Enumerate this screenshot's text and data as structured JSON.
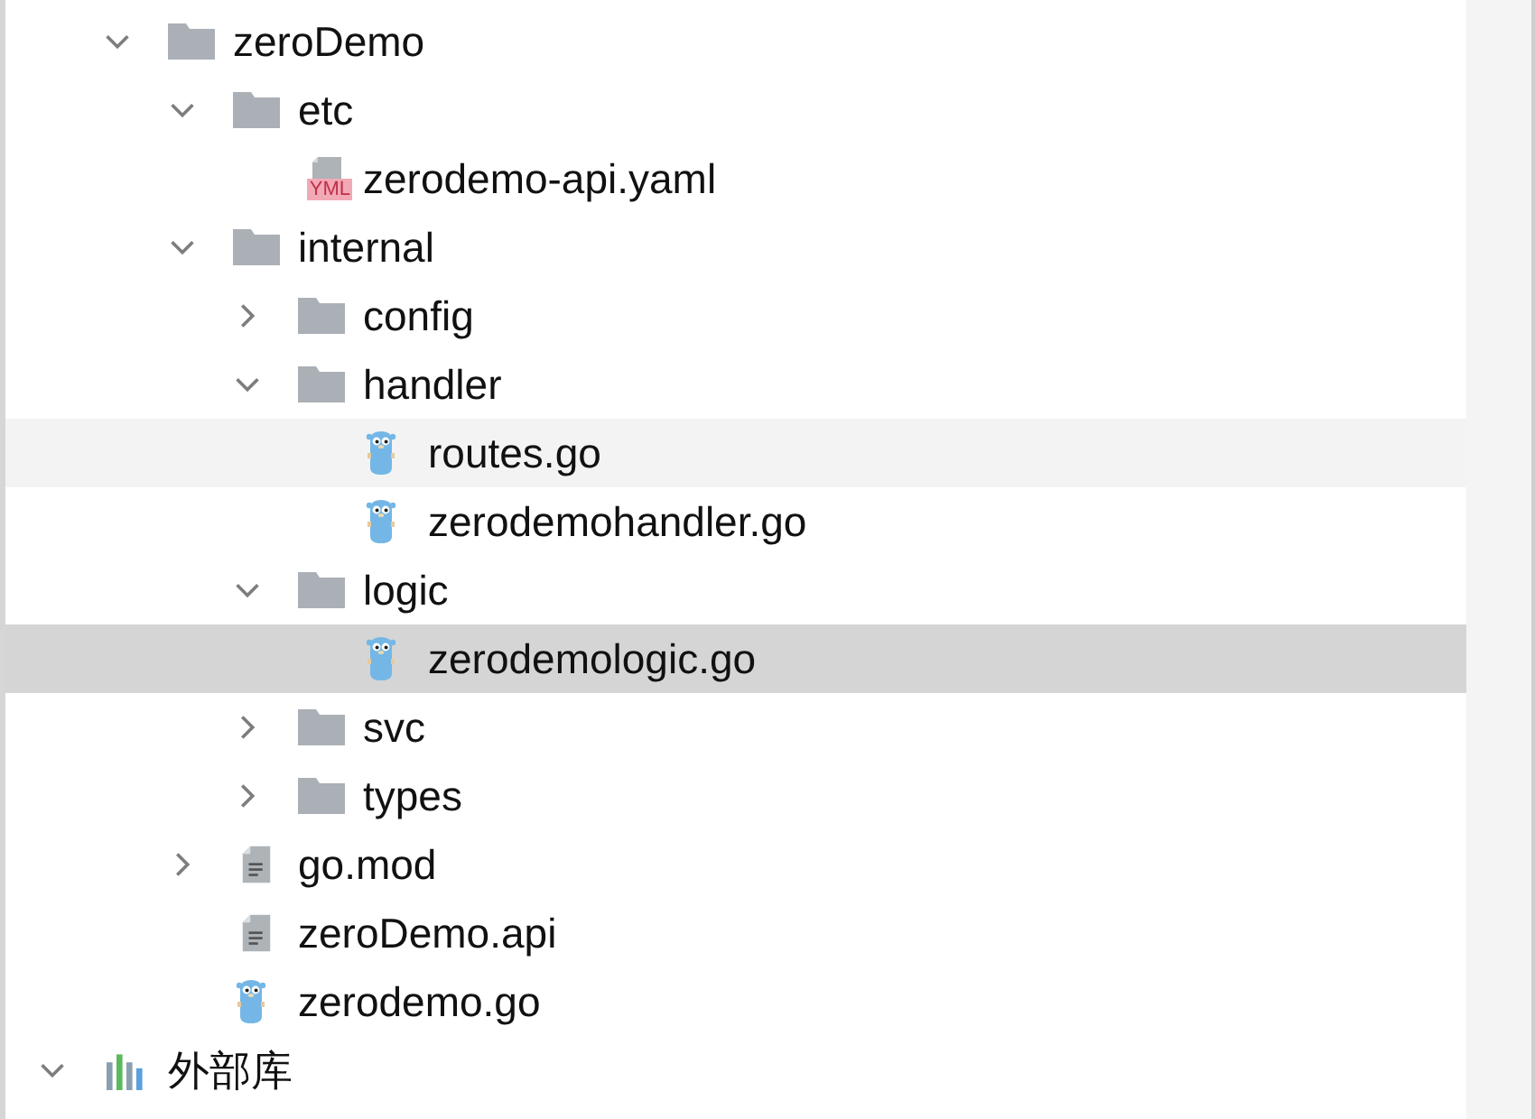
{
  "tree": [
    {
      "label": "zeroDemo",
      "kind": "folder",
      "expanded": true,
      "selected": false,
      "hovered": false,
      "children": [
        {
          "label": "etc",
          "kind": "folder",
          "expanded": true,
          "selected": false,
          "hovered": false,
          "children": [
            {
              "label": "zerodemo-api.yaml",
              "kind": "yaml",
              "selected": false,
              "hovered": false,
              "badge": "YML"
            }
          ]
        },
        {
          "label": "internal",
          "kind": "folder",
          "expanded": true,
          "selected": false,
          "hovered": false,
          "children": [
            {
              "label": "config",
              "kind": "folder",
              "expanded": false,
              "selected": false,
              "hovered": false
            },
            {
              "label": "handler",
              "kind": "folder",
              "expanded": true,
              "selected": false,
              "hovered": false,
              "children": [
                {
                  "label": "routes.go",
                  "kind": "go",
                  "selected": false,
                  "hovered": true
                },
                {
                  "label": "zerodemohandler.go",
                  "kind": "go",
                  "selected": false,
                  "hovered": false
                }
              ]
            },
            {
              "label": "logic",
              "kind": "folder",
              "expanded": true,
              "selected": false,
              "hovered": false,
              "children": [
                {
                  "label": "zerodemologic.go",
                  "kind": "go",
                  "selected": true,
                  "hovered": false
                }
              ]
            },
            {
              "label": "svc",
              "kind": "folder",
              "expanded": false,
              "selected": false,
              "hovered": false
            },
            {
              "label": "types",
              "kind": "folder",
              "expanded": false,
              "selected": false,
              "hovered": false
            }
          ]
        },
        {
          "label": "go.mod",
          "kind": "text",
          "expanded": false,
          "selected": false,
          "hovered": false
        },
        {
          "label": "zeroDemo.api",
          "kind": "text",
          "selected": false,
          "hovered": false
        },
        {
          "label": "zerodemo.go",
          "kind": "go",
          "selected": false,
          "hovered": false
        }
      ]
    }
  ],
  "external_libraries": {
    "label": "外部库",
    "expanded": true
  }
}
